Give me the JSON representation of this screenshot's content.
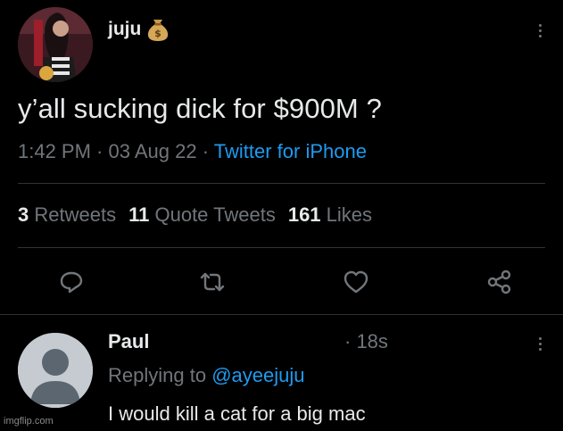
{
  "tweet": {
    "display_name": "juju",
    "name_emoji": "moneybag-icon",
    "text": "y’all sucking dick for $900M ?",
    "time": "1:42 PM",
    "date": "03 Aug 22",
    "separator": " · ",
    "source": "Twitter for iPhone",
    "stats": {
      "retweets_count": "3",
      "retweets_label": "Retweets",
      "quotes_count": "11",
      "quotes_label": "Quote Tweets",
      "likes_count": "161",
      "likes_label": "Likes"
    },
    "actions": [
      "reply-icon",
      "retweet-icon",
      "like-icon",
      "share-icon"
    ]
  },
  "reply": {
    "display_name": "Paul",
    "time": "· 18s",
    "replying_prefix": "Replying to ",
    "replying_handle": "@ayeejuju",
    "text": "I would kill a cat for a big mac"
  },
  "watermark": "imgflip.com",
  "colors": {
    "background": "#000000",
    "primary_text": "#e7e9ea",
    "secondary_text": "#71767b",
    "link": "#1d9bf0",
    "divider": "#2f3336"
  }
}
